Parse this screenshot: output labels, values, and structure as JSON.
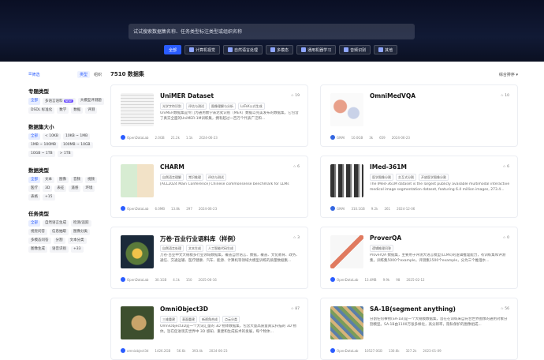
{
  "search": {
    "placeholder": "试试搜索数据集名称、任务类型标注类型或组织名称"
  },
  "categories": [
    "全部",
    "计算机视觉",
    "自然语言处理",
    "多模态",
    "通用机器学习",
    "音频识别",
    "其他"
  ],
  "sidebar": {
    "filter_label": "筛选",
    "toggle_type": "类型",
    "toggle_org": "组织",
    "sections": [
      {
        "title": "专题类型",
        "tags": [
          "全部",
          "多语言语料",
          "大模型评测题",
          "DSDL 标准化",
          "数学",
          "数据",
          "评测"
        ]
      },
      {
        "title": "数据集大小",
        "tags": [
          "全部",
          "< 10KB",
          "10KB ~ 1MB",
          "1MB ~ 100MB",
          "100MB ~ 10GB",
          "10GB ~ 1TB",
          "> 1TB"
        ]
      },
      {
        "title": "数据类型",
        "tags": [
          "全部",
          "文本",
          "图像",
          "音频",
          "视频",
          "医疗",
          "3D",
          "表征",
          "遥感",
          "环境",
          "表格",
          "+15"
        ]
      },
      {
        "title": "任务类型",
        "tags": [
          "全部",
          "自然语言生成",
          "检测/追踪",
          "视觉问答",
          "信息抽取",
          "图像分类",
          "多模态问答",
          "分割",
          "文本分类",
          "图像生成",
          "语音识别",
          "+33"
        ]
      }
    ]
  },
  "main": {
    "count": "7510 数据集",
    "sort": "综合排序"
  },
  "cards": [
    {
      "title": "UniMER Dataset",
      "stars": "19",
      "tags": [
        "光学字符识别",
        "评估与测试",
        "图像理解与分析",
        "LaTeX公式生成"
      ],
      "desc": "UniMER数据集是专门为通用数学表达式识别（MER）数据以完美发布的数据集，它包含了真实全面的UniMER-1M训练集，拥有超过一百万个代表广泛和...",
      "size": "2.0GB",
      "views": "21.2k",
      "downloads": "1.1k",
      "date": "2024-06-23",
      "publisher": "OpenDataLab"
    },
    {
      "title": "OmniMedVQA",
      "stars": "10",
      "tags": [],
      "desc": "",
      "size": "10.0GB",
      "views": "3k",
      "downloads": "659",
      "date": "2024-06-23",
      "publisher": "GMAI"
    },
    {
      "title": "CHARM",
      "stars": "6",
      "tags": [
        "自然语言理解",
        "常识推理",
        "评估与测试"
      ],
      "desc": "[ACL2024 Main Conference] Chinese commonsense benchmark for LLMs",
      "size": "6.0MB",
      "views": "13.8k",
      "downloads": "297",
      "date": "2024-06-23",
      "publisher": "OpenDataLab"
    },
    {
      "title": "IMed-361M",
      "stars": "6",
      "tags": [
        "医学图像分割",
        "交互式分割",
        "开放医学图像分割"
      ],
      "desc": "The IMed-361M dataset is the largest publicly available multimodal interactive medical image segmentation dataset, featuring 6.4 million images, 273.4...",
      "size": "310.1GB",
      "views": "9.2k",
      "downloads": "261",
      "date": "2024-12-06",
      "publisher": "GMAI"
    },
    {
      "title": "万卷·百业行业语料库（样例）",
      "stars": "3",
      "tags": [
        "自然语言处理",
        "文本生成",
        "人工智能代码生成"
      ],
      "desc": "万卷·百业中文大规模多行业领域数据集，覆盖自然语言、数据，覆盖、文化教育、政务、通信、交通运输、医疗健康、汽车、能源、计算机等领域大模型训练的质量数据集...",
      "size": "30.1GB",
      "views": "4.1k",
      "downloads": "150",
      "date": "2025-06-16",
      "publisher": "OpenDataLab"
    },
    {
      "title": "ProverQA",
      "stars": "0",
      "tags": [
        "逻辑推理问答"
      ],
      "desc": "ProverQA 数据集，主要用于评测大语言模型(LLMs)的逻辑推理能力，有训练集和评测集，训练集5000个example，评测集1500个example，分为三个推理水...",
      "size": "13.4MB",
      "views": "9.9k",
      "downloads": "98",
      "date": "2025-02-12",
      "publisher": "OpenDataLab"
    },
    {
      "title": "OmniObject3D",
      "stars": "87",
      "tags": [
        "三维重建",
        "表面重建",
        "新视角合成",
        "点云分类"
      ],
      "desc": "OmniObject3D是一个大词汇量的 3D 物体数据集，包含大量高质量真实扫描的 3D 物体。旨在促进现实世界中 3D 感知、重建和生成技术的发展，每个物体...",
      "size": "1426.2GB",
      "views": "56.6k",
      "downloads": "393.4k",
      "date": "2024-06-23",
      "publisher": "omniobject3d"
    },
    {
      "title": "SA-1B(segment anything)",
      "stars": "56",
      "tags": [],
      "desc": "分割任何事物(SA-1B)是一个大规模数据集，旨在在训练来自符合世界图像的通用对象分割模型。SA-1B由1100万张多样化，高分辨率，隐私保护的图像组成...",
      "size": "10527.0GB",
      "views": "130.6k",
      "downloads": "327.2k",
      "date": "2023-01-09",
      "publisher": "OpenDataLab"
    }
  ],
  "colors": {
    "accent": "#2a5cff",
    "hero": "#0a0f24"
  }
}
